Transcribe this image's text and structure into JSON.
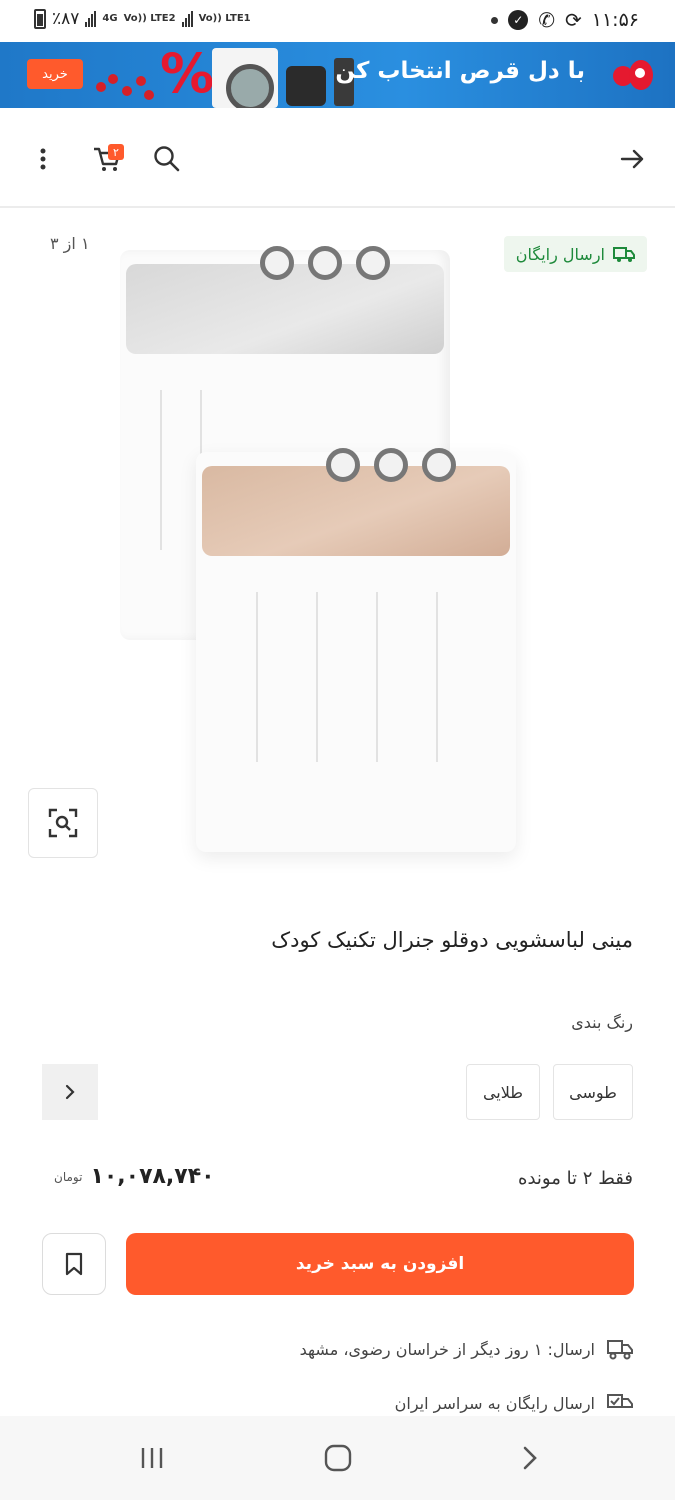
{
  "status_bar": {
    "battery_text": "٪۸۷",
    "net1": "4G",
    "net1b": "Vo)) LTE2",
    "net2": "Vo)) LTE1",
    "time": "۱۱:۵۶"
  },
  "banner": {
    "buy_label": "خرید",
    "headline": "با دل قرص انتخاب کن",
    "percent": "%"
  },
  "nav": {
    "cart_count": "۲"
  },
  "gallery": {
    "counter": "۱ از ۳",
    "free_shipping": "ارسال رایگان"
  },
  "product": {
    "title": "مینی لباسشویی دوقلو جنرال تکنیک کودک",
    "color_label": "رنگ بندی",
    "colors": [
      "طوسی",
      "طلایی"
    ],
    "stock_note": "فقط ۲ تا مونده",
    "price": "۱۰,۰۷۸,۷۴۰",
    "currency": "تومان",
    "add_to_cart": "افزودن به سبد خرید"
  },
  "shipping": {
    "delivery": "ارسال: ۱ روز دیگر از خراسان رضوی، مشهد",
    "free_nationwide": "ارسال رایگان به سراسر ایران"
  },
  "colors": {
    "accent": "#ff5a2c",
    "banner_blue": "#2a8fe0",
    "free_green": "#1e8a3b"
  }
}
